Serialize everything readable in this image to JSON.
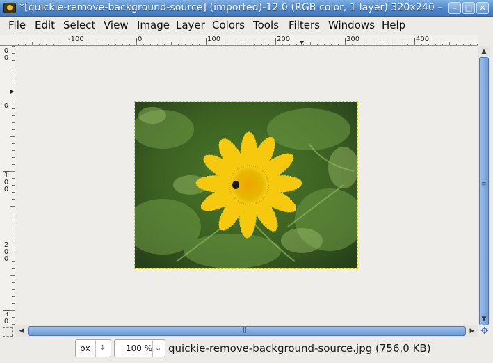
{
  "window": {
    "title": "*[quickie-remove-background-source] (imported)-12.0 (RGB color, 1 layer) 320x240 –",
    "controls": {
      "minimize": "–",
      "maximize": "□",
      "close": "✕"
    }
  },
  "menubar": {
    "items": [
      {
        "label": "File"
      },
      {
        "label": "Edit"
      },
      {
        "label": "Select"
      },
      {
        "label": "View"
      },
      {
        "label": "Image"
      },
      {
        "label": "Layer"
      },
      {
        "label": "Colors"
      },
      {
        "label": "Tools"
      },
      {
        "label": "Filters"
      },
      {
        "label": "Windows"
      },
      {
        "label": "Help"
      }
    ]
  },
  "rulers": {
    "horizontal_labels": [
      "-100",
      "0",
      "100",
      "200",
      "300",
      "400"
    ],
    "vertical_labels": [
      "-100",
      "0",
      "100",
      "200",
      "300"
    ]
  },
  "canvas": {
    "image_size": "320x240",
    "selection": "marching-ants"
  },
  "statusbar": {
    "unit": "px",
    "zoom": "100 %",
    "file_info": "quickie-remove-background-source.jpg (756.0 KB)"
  },
  "icons": {
    "app": "gimp-icon",
    "unit_stepper": "updown-icon",
    "zoom_dropdown": "chevron-down-icon",
    "navigate": "navigate-icon",
    "quick_mask": "quick-mask-icon"
  },
  "colors": {
    "titlebar": "#4f86c9",
    "selection": "#d9d200",
    "flower_yellow": "#f6c90f",
    "foliage_green": "#3f5e22"
  }
}
